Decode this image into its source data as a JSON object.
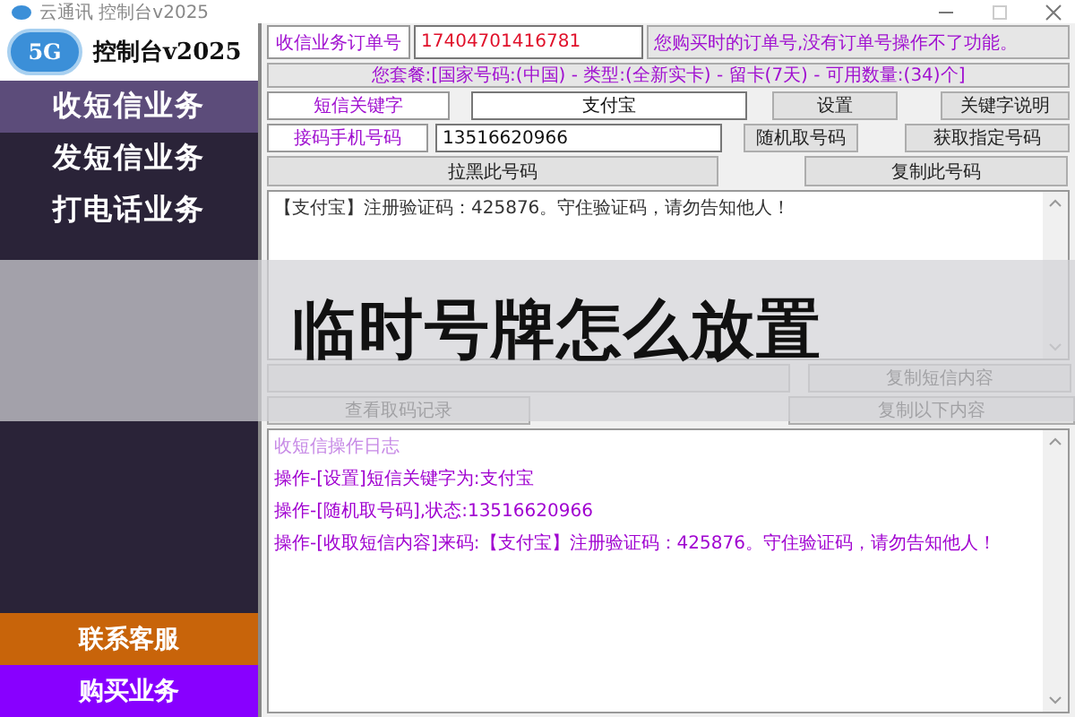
{
  "window": {
    "title": "云通讯 控制台v2025"
  },
  "logo": {
    "badge": "5G",
    "title": "控制台v2025"
  },
  "sidebar": {
    "items": [
      {
        "label": "收短信业务",
        "selected": true
      },
      {
        "label": "发短信业务",
        "selected": false
      },
      {
        "label": "打电话业务",
        "selected": false
      }
    ],
    "bottom_buttons": [
      {
        "label": "联系客服",
        "color": "#c8640a"
      },
      {
        "label": "购买业务",
        "color": "#8800ff"
      }
    ]
  },
  "order": {
    "label": "收信业务订单号",
    "value": "17404701416781",
    "hint": "您购买时的订单号,没有订单号操作不了功能。"
  },
  "package": "您套餐:[国家号码:(中国) - 类型:(全新实卡) - 留卡(7天) - 可用数量:(34)个]",
  "keyword": {
    "label": "短信关键字",
    "value": "支付宝",
    "buttons": [
      "设置",
      "关键字说明"
    ]
  },
  "phone": {
    "label": "接码手机号码",
    "value": "13516620966",
    "buttons": [
      "随机取号码",
      "获取指定号码"
    ]
  },
  "phone_actions": [
    "拉黑此号码",
    "复制此号码"
  ],
  "message": "【支付宝】注册验证码：425876。守住验证码，请勿告知他人！",
  "message_actions": [
    "复制短信内容"
  ],
  "record_actions": [
    "查看取码记录",
    "复制以下内容"
  ],
  "log": {
    "title": "收短信操作日志",
    "lines": [
      "操作-[设置]短信关键字为:支付宝",
      "操作-[随机取号码],状态:13516620966",
      "操作-[收取短信内容]来码:【支付宝】注册验证码：425876。守住验证码，请勿告知他人！"
    ]
  },
  "overlay_title": "临时号牌怎么放置"
}
